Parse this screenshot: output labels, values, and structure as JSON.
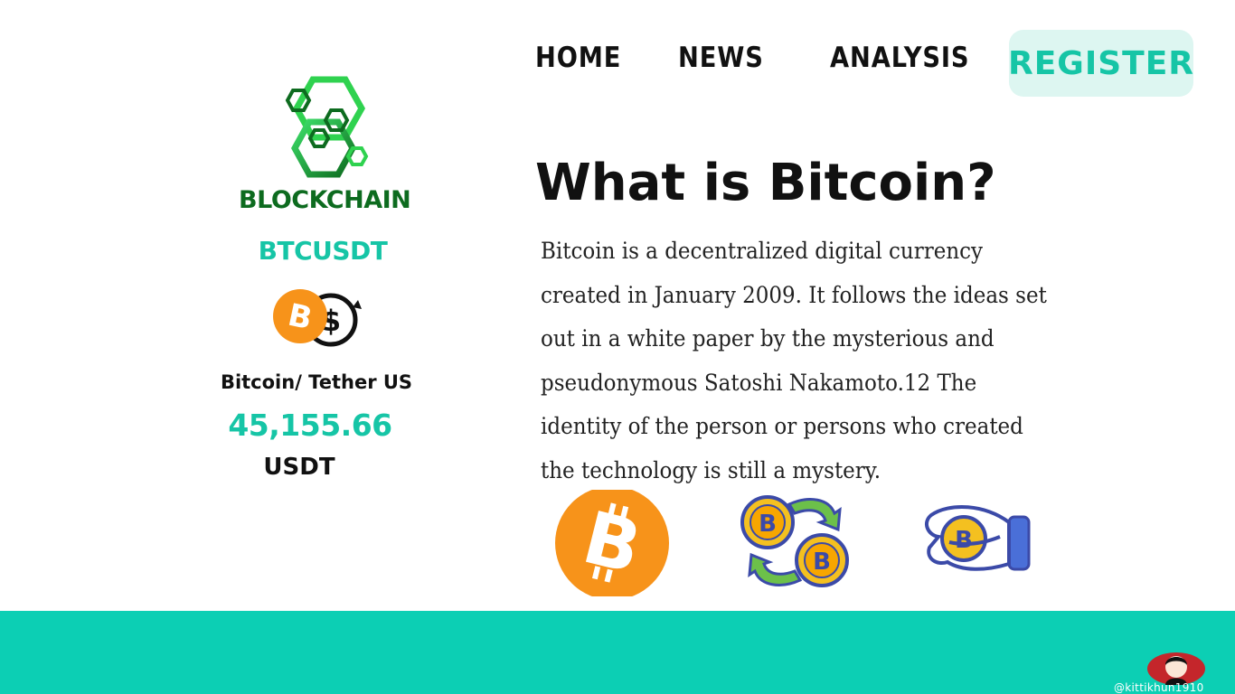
{
  "nav": {
    "home": "HOME",
    "news": "NEWS",
    "analysis": "ANALYSIS",
    "register": "REGISTER"
  },
  "brand": {
    "logo_text": "BLOCKCHAIN",
    "logo_icon": "hexagon-chain-icon"
  },
  "ticker": {
    "symbol": "BTCUSDT",
    "pair_icon": "bitcoin-dollar-exchange-icon",
    "pair_name": "Bitcoin/ Tether US",
    "price": "45,155.66",
    "unit": "USDT"
  },
  "article": {
    "title": "What is Bitcoin?",
    "body": "Bitcoin is a decentralized digital currency created in January 2009. It follows the ideas set out in a white paper by the mysterious and pseudonymous Satoshi Nakamoto.12 The identity of the person or persons who created the technology is still a mystery."
  },
  "icons": [
    "bitcoin-icon",
    "bitcoin-exchange-icon",
    "hand-holding-bitcoin-icon"
  ],
  "footer": {
    "handle": "@kittikhun1910"
  },
  "colors": {
    "accent": "#16c5a6",
    "footer": "#0ccfb4",
    "register_bg": "#ddf6f1",
    "bitcoin_orange": "#f7931a",
    "logo_green": "#0d6b1f"
  }
}
